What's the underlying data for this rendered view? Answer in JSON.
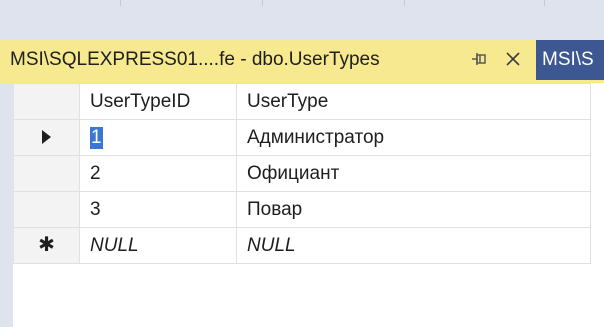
{
  "tabs": {
    "active": {
      "label": "MSI\\SQLEXPRESS01....fe - dbo.UserTypes"
    },
    "inactive": {
      "label": "MSI\\S"
    }
  },
  "grid": {
    "columns": [
      "UserTypeID",
      "UserType"
    ],
    "rows": [
      {
        "marker": "current",
        "cells": [
          "1",
          "Администратор"
        ]
      },
      {
        "marker": "",
        "cells": [
          "2",
          "Официант"
        ]
      },
      {
        "marker": "",
        "cells": [
          "3",
          "Повар"
        ]
      },
      {
        "marker": "new",
        "cells": [
          "NULL",
          "NULL"
        ]
      }
    ],
    "selected_cell": {
      "row": 0,
      "column": 0
    }
  },
  "colors": {
    "active_tab": "#f7e98f",
    "inactive_tab": "#3c5791",
    "chrome": "#dfe3ee",
    "selection": "#3b76d6"
  },
  "icons": {
    "pin": "pin-icon",
    "close": "close-icon",
    "current_row": "row-arrow-icon",
    "new_row": "new-row-star-icon"
  }
}
